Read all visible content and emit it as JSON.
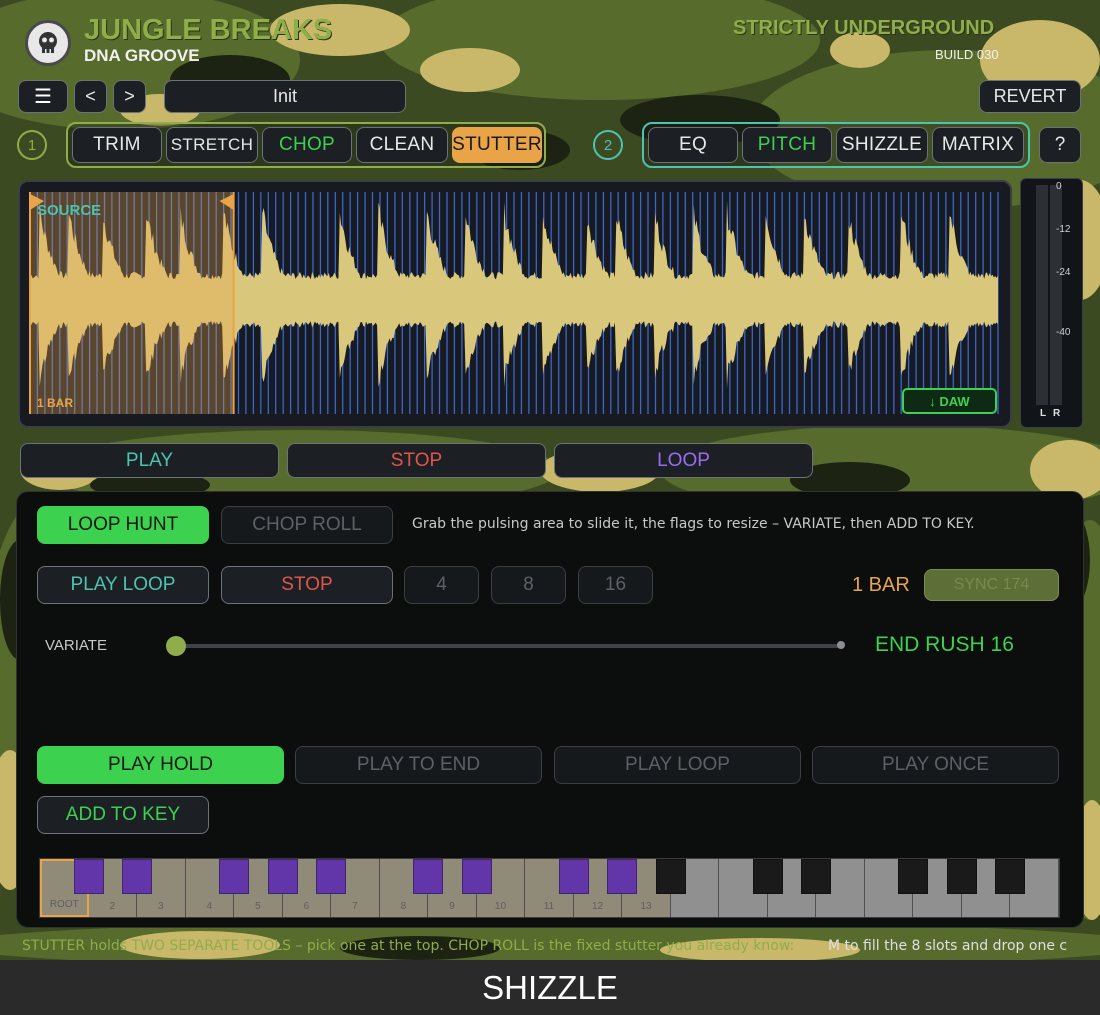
{
  "colors": {
    "accent_orange": "#e9a448",
    "accent_green": "#3cd14f",
    "teal": "#4dc3b0",
    "red_text": "#e0554a",
    "purple_text": "#9b6cf0",
    "wave_fill": "#d9c77c",
    "olive": "#8fae4a"
  },
  "header": {
    "app_title": "JUNGLE BREAKS",
    "subtitle": "DNA GROOVE",
    "brand": "STRICTLY UNDERGROUND",
    "build": "BUILD 030",
    "logo_icon": "skull-badge-icon"
  },
  "toolbar": {
    "menu_icon": "hamburger-menu-icon",
    "prev_label": "<",
    "next_label": ">",
    "preset_name": "Init",
    "revert_label": "REVERT"
  },
  "groups": [
    {
      "number": "1",
      "tabs": [
        {
          "label": "TRIM",
          "state": "normal"
        },
        {
          "label": "STRETCH",
          "state": "normal"
        },
        {
          "label": "CHOP",
          "state": "green"
        },
        {
          "label": "CLEAN",
          "state": "normal"
        },
        {
          "label": "STUTTER",
          "state": "selected"
        }
      ]
    },
    {
      "number": "2",
      "tabs": [
        {
          "label": "EQ",
          "state": "normal"
        },
        {
          "label": "PITCH",
          "state": "green"
        },
        {
          "label": "SHIZZLE",
          "state": "normal"
        },
        {
          "label": "MATRIX",
          "state": "normal"
        }
      ]
    }
  ],
  "help_label": "?",
  "waveform": {
    "source_label": "SOURCE",
    "bar_label": "1 BAR",
    "daw_label": "↓ DAW",
    "selection_fraction": [
      0.0,
      0.2
    ]
  },
  "meter": {
    "ticks": [
      "0",
      "-12",
      "-24",
      "-40"
    ],
    "left_label": "L",
    "right_label": "R"
  },
  "transport": {
    "play": "PLAY",
    "stop": "STOP",
    "loop": "LOOP"
  },
  "stutter": {
    "mode_loop_hunt": "LOOP HUNT",
    "mode_chop_roll": "CHOP ROLL",
    "hint": "Grab the pulsing area to slide it, the flags to resize – VARIATE, then ADD TO KEY.",
    "play_loop": "PLAY LOOP",
    "stop": "STOP",
    "div_4": "4",
    "div_8": "8",
    "div_16": "16",
    "length_readout": "1 BAR",
    "sync_label": "SYNC 174",
    "variate_label": "VARIATE",
    "variate_value_fraction": 0.0,
    "variate_readout": "END RUSH 16",
    "play_hold": "PLAY HOLD",
    "play_to_end": "PLAY TO END",
    "play_loop_mode": "PLAY LOOP",
    "play_once": "PLAY ONCE",
    "add_to_key": "ADD TO KEY"
  },
  "keyboard": {
    "labels": [
      "ROOT",
      "2",
      "3",
      "4",
      "5",
      "6",
      "7",
      "8",
      "9",
      "10",
      "11",
      "12",
      "13"
    ]
  },
  "ticker": "STUTTER holds TWO SEPARATE TOOLS – pick one at the top. CHOP ROLL is the fixed stutter you already know:",
  "ticker_right": "M to fill the 8 slots and drop one c",
  "footer_label": "SHIZZLE"
}
